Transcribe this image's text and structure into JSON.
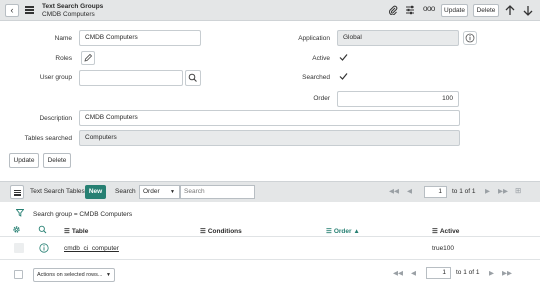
{
  "header": {
    "back_icon": "‹",
    "title": "Text Search Groups",
    "subtitle": "CMDB Computers",
    "update_label": "Update",
    "delete_label": "Delete"
  },
  "form": {
    "name_label": "Name",
    "name_value": "CMDB Computers",
    "application_label": "Application",
    "application_value": "Global",
    "roles_label": "Roles",
    "active_label": "Active",
    "user_group_label": "User group",
    "user_group_value": "",
    "searched_label": "Searched",
    "order_label": "Order",
    "order_value": "100",
    "description_label": "Description",
    "description_value": "CMDB Computers",
    "tables_searched_label": "Tables searched",
    "tables_searched_value": "Computers",
    "update_label": "Update",
    "delete_label": "Delete"
  },
  "related_list": {
    "title": "Text Search Tables",
    "new_label": "New",
    "search_label": "Search",
    "search_field": "Order",
    "search_placeholder": "Search",
    "page_value": "1",
    "page_of": "to 1 of 1",
    "breadcrumb": "Search group = CMDB Computers",
    "columns": [
      "Table",
      "Conditions",
      "Order",
      "Active"
    ],
    "rows": [
      {
        "table": "cmdb_ci_computer",
        "conditions": "",
        "order": "100",
        "active": "true"
      }
    ],
    "actions_placeholder": "Actions on selected rows...",
    "footer_page_value": "1",
    "footer_page_of": "to 1 of 1"
  },
  "colors": {
    "accent": "#278073",
    "header_bg": "#e4e6e7",
    "readonly_bg": "#e8eaeb"
  }
}
